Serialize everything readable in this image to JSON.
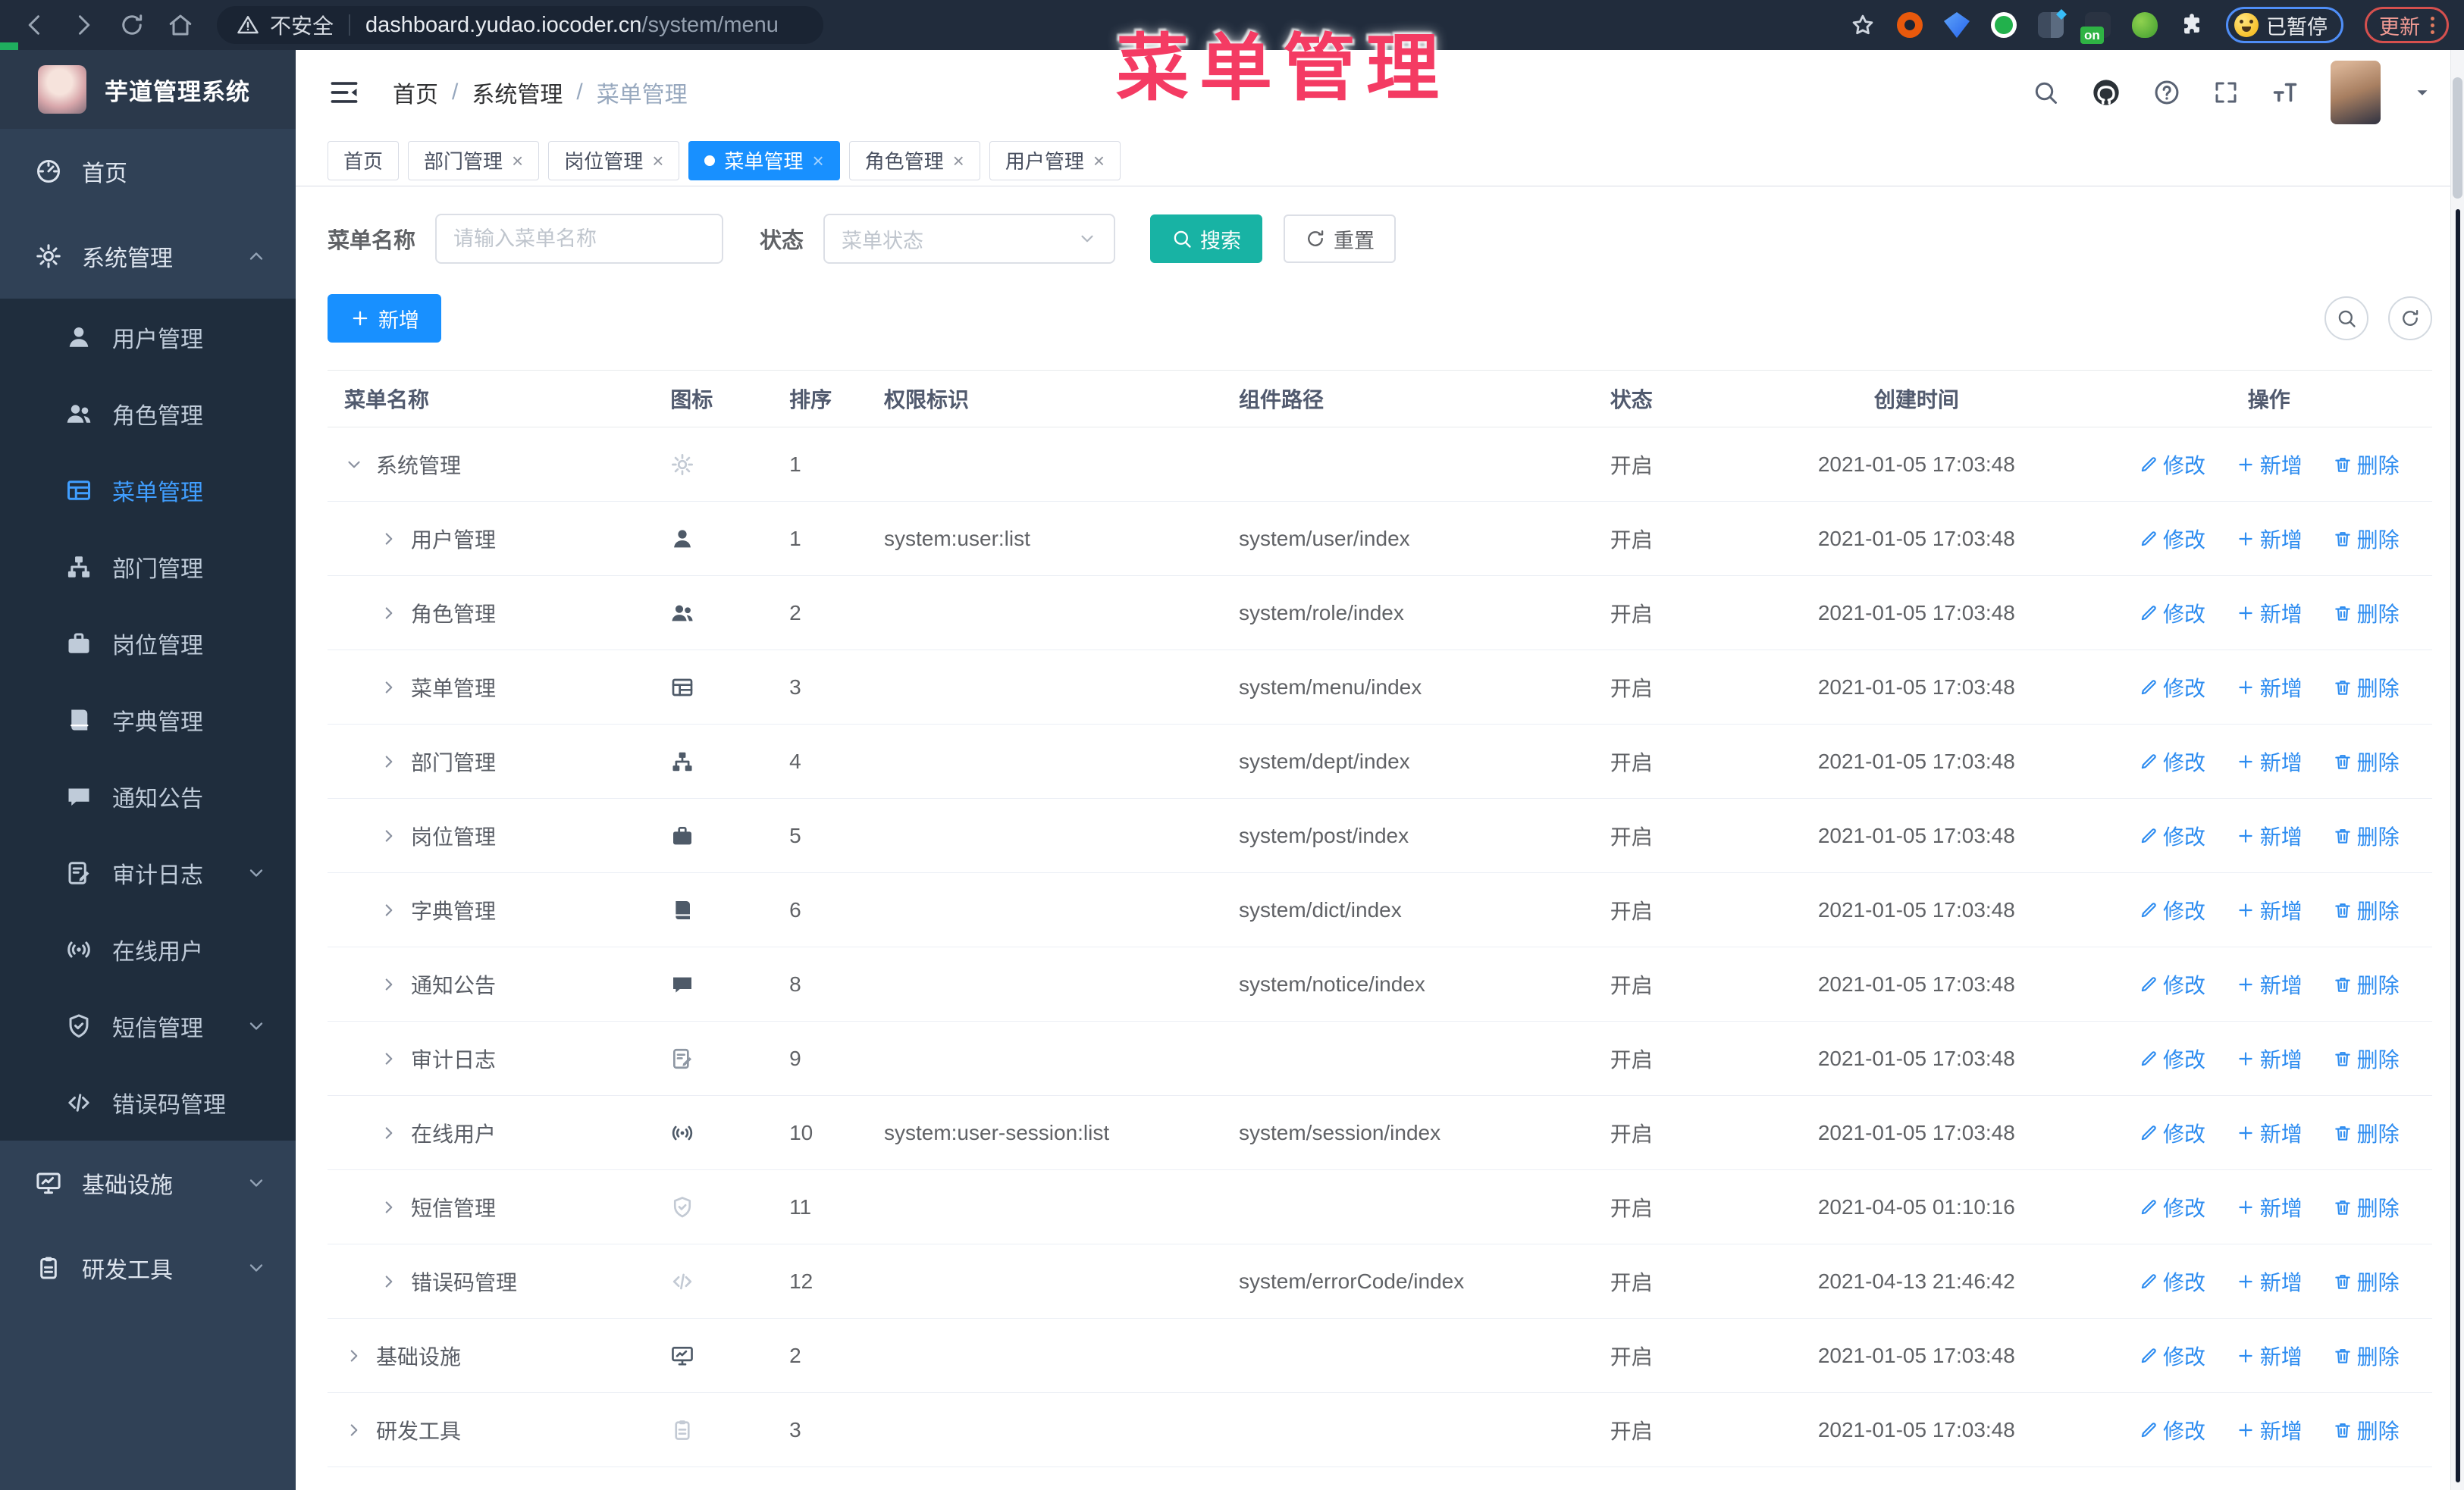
{
  "browser": {
    "security_label": "不安全",
    "url_host": "dashboard.yudao.iocoder.cn",
    "url_path": "/system/menu",
    "extension_on_badge": "on",
    "paused_label": "已暂停",
    "update_label": "更新"
  },
  "overlay_title": "菜单管理",
  "sidebar": {
    "logo_title": "芋道管理系统",
    "items": [
      {
        "label": "首页",
        "icon": "dashboard-icon",
        "level": 0
      },
      {
        "label": "系统管理",
        "icon": "gear-icon",
        "level": 0,
        "arrow": "up"
      },
      {
        "label": "用户管理",
        "icon": "user-icon",
        "level": 1
      },
      {
        "label": "角色管理",
        "icon": "peoples-icon",
        "level": 1
      },
      {
        "label": "菜单管理",
        "icon": "tree-table-icon",
        "level": 1,
        "active": true
      },
      {
        "label": "部门管理",
        "icon": "tree-icon",
        "level": 1
      },
      {
        "label": "岗位管理",
        "icon": "post-icon",
        "level": 1
      },
      {
        "label": "字典管理",
        "icon": "dict-icon",
        "level": 1
      },
      {
        "label": "通知公告",
        "icon": "message-icon",
        "level": 1
      },
      {
        "label": "审计日志",
        "icon": "log-icon",
        "level": 1,
        "arrow": "down"
      },
      {
        "label": "在线用户",
        "icon": "online-icon",
        "level": 1
      },
      {
        "label": "短信管理",
        "icon": "sms-icon",
        "level": 1,
        "arrow": "down"
      },
      {
        "label": "错误码管理",
        "icon": "code-icon",
        "level": 1
      },
      {
        "label": "基础设施",
        "icon": "monitor-icon",
        "level": 0,
        "arrow": "down"
      },
      {
        "label": "研发工具",
        "icon": "tool-icon",
        "level": 0,
        "arrow": "down"
      }
    ]
  },
  "header": {
    "breadcrumb": [
      "首页",
      "系统管理",
      "菜单管理"
    ]
  },
  "tabs": [
    {
      "label": "首页",
      "closable": false,
      "active": false
    },
    {
      "label": "部门管理",
      "closable": true,
      "active": false
    },
    {
      "label": "岗位管理",
      "closable": true,
      "active": false
    },
    {
      "label": "菜单管理",
      "closable": true,
      "active": true
    },
    {
      "label": "角色管理",
      "closable": true,
      "active": false
    },
    {
      "label": "用户管理",
      "closable": true,
      "active": false
    }
  ],
  "filters": {
    "name_label": "菜单名称",
    "name_placeholder": "请输入菜单名称",
    "status_label": "状态",
    "status_placeholder": "菜单状态",
    "search_label": "搜索",
    "reset_label": "重置"
  },
  "toolbar": {
    "add_label": "新增"
  },
  "table": {
    "headers": [
      "菜单名称",
      "图标",
      "排序",
      "权限标识",
      "组件路径",
      "状态",
      "创建时间",
      "操作"
    ],
    "actions": {
      "edit": "修改",
      "add": "新增",
      "delete": "删除"
    },
    "rows": [
      {
        "name": "系统管理",
        "level": 0,
        "expanded": true,
        "icon": "gear-icon",
        "tone": "light",
        "order": "1",
        "perm": "",
        "path": "",
        "status": "开启",
        "time": "2021-01-05 17:03:48"
      },
      {
        "name": "用户管理",
        "level": 1,
        "expanded": false,
        "icon": "user-icon",
        "tone": "dark",
        "order": "1",
        "perm": "system:user:list",
        "path": "system/user/index",
        "status": "开启",
        "time": "2021-01-05 17:03:48"
      },
      {
        "name": "角色管理",
        "level": 1,
        "expanded": false,
        "icon": "peoples-icon",
        "tone": "dark",
        "order": "2",
        "perm": "",
        "path": "system/role/index",
        "status": "开启",
        "time": "2021-01-05 17:03:48"
      },
      {
        "name": "菜单管理",
        "level": 1,
        "expanded": false,
        "icon": "tree-table-icon",
        "tone": "dark",
        "order": "3",
        "perm": "",
        "path": "system/menu/index",
        "status": "开启",
        "time": "2021-01-05 17:03:48"
      },
      {
        "name": "部门管理",
        "level": 1,
        "expanded": false,
        "icon": "tree-icon",
        "tone": "dark",
        "order": "4",
        "perm": "",
        "path": "system/dept/index",
        "status": "开启",
        "time": "2021-01-05 17:03:48"
      },
      {
        "name": "岗位管理",
        "level": 1,
        "expanded": false,
        "icon": "post-icon",
        "tone": "dark",
        "order": "5",
        "perm": "",
        "path": "system/post/index",
        "status": "开启",
        "time": "2021-01-05 17:03:48"
      },
      {
        "name": "字典管理",
        "level": 1,
        "expanded": false,
        "icon": "dict-icon",
        "tone": "dark",
        "order": "6",
        "perm": "",
        "path": "system/dict/index",
        "status": "开启",
        "time": "2021-01-05 17:03:48"
      },
      {
        "name": "通知公告",
        "level": 1,
        "expanded": false,
        "icon": "message-icon",
        "tone": "dark",
        "order": "8",
        "perm": "",
        "path": "system/notice/index",
        "status": "开启",
        "time": "2021-01-05 17:03:48"
      },
      {
        "name": "审计日志",
        "level": 1,
        "expanded": false,
        "icon": "log-icon",
        "tone": "mid",
        "order": "9",
        "perm": "",
        "path": "",
        "status": "开启",
        "time": "2021-01-05 17:03:48"
      },
      {
        "name": "在线用户",
        "level": 1,
        "expanded": false,
        "icon": "online-icon",
        "tone": "dark",
        "order": "10",
        "perm": "system:user-session:list",
        "path": "system/session/index",
        "status": "开启",
        "time": "2021-01-05 17:03:48"
      },
      {
        "name": "短信管理",
        "level": 1,
        "expanded": false,
        "icon": "sms-icon",
        "tone": "light",
        "order": "11",
        "perm": "",
        "path": "",
        "status": "开启",
        "time": "2021-04-05 01:10:16"
      },
      {
        "name": "错误码管理",
        "level": 1,
        "expanded": false,
        "icon": "code-icon",
        "tone": "light",
        "order": "12",
        "perm": "",
        "path": "system/errorCode/index",
        "status": "开启",
        "time": "2021-04-13 21:46:42"
      },
      {
        "name": "基础设施",
        "level": 0,
        "expanded": false,
        "icon": "monitor-icon",
        "tone": "dark",
        "order": "2",
        "perm": "",
        "path": "",
        "status": "开启",
        "time": "2021-01-05 17:03:48"
      },
      {
        "name": "研发工具",
        "level": 0,
        "expanded": false,
        "icon": "tool-icon",
        "tone": "light",
        "order": "3",
        "perm": "",
        "path": "",
        "status": "开启",
        "time": "2021-01-05 17:03:48"
      }
    ]
  },
  "colors": {
    "accent": "#1890ff",
    "search_button": "#18b3a4",
    "sidebar_active": "#409eff",
    "overlay_red": "#f43b63",
    "sidebar_bg": "#304156",
    "submenu_bg": "#1f2d3d"
  }
}
